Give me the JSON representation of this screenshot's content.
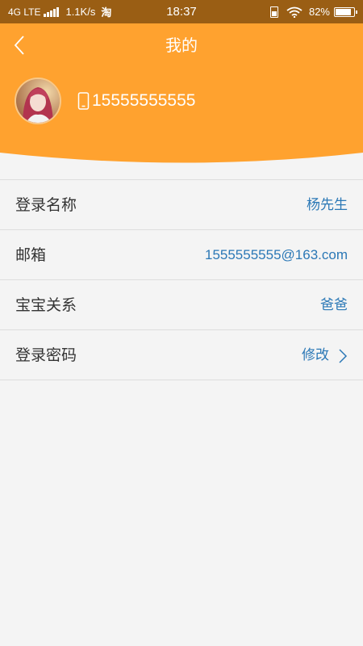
{
  "status_bar": {
    "network": "4G LTE",
    "speed": "1.1K/s",
    "app_icon_text": "淘",
    "time": "18:37",
    "battery": "82%"
  },
  "header": {
    "title": "我的",
    "phone": "15555555555"
  },
  "profile_items": [
    {
      "label": "登录名称",
      "value": "杨先生"
    },
    {
      "label": "邮箱",
      "value": "1555555555@163.com"
    },
    {
      "label": "宝宝关系",
      "value": "爸爸"
    },
    {
      "label": "登录密码",
      "value": "修改"
    }
  ],
  "colors": {
    "header_orange": "#ffa22f",
    "status_bar_bg": "#9a5e14",
    "value_blue": "#2b78b6",
    "page_bg": "#f4f4f4"
  },
  "icons": {
    "back": "back-arrow-icon",
    "phone": "mobile-phone-icon",
    "chevron": "chevron-right-icon"
  }
}
